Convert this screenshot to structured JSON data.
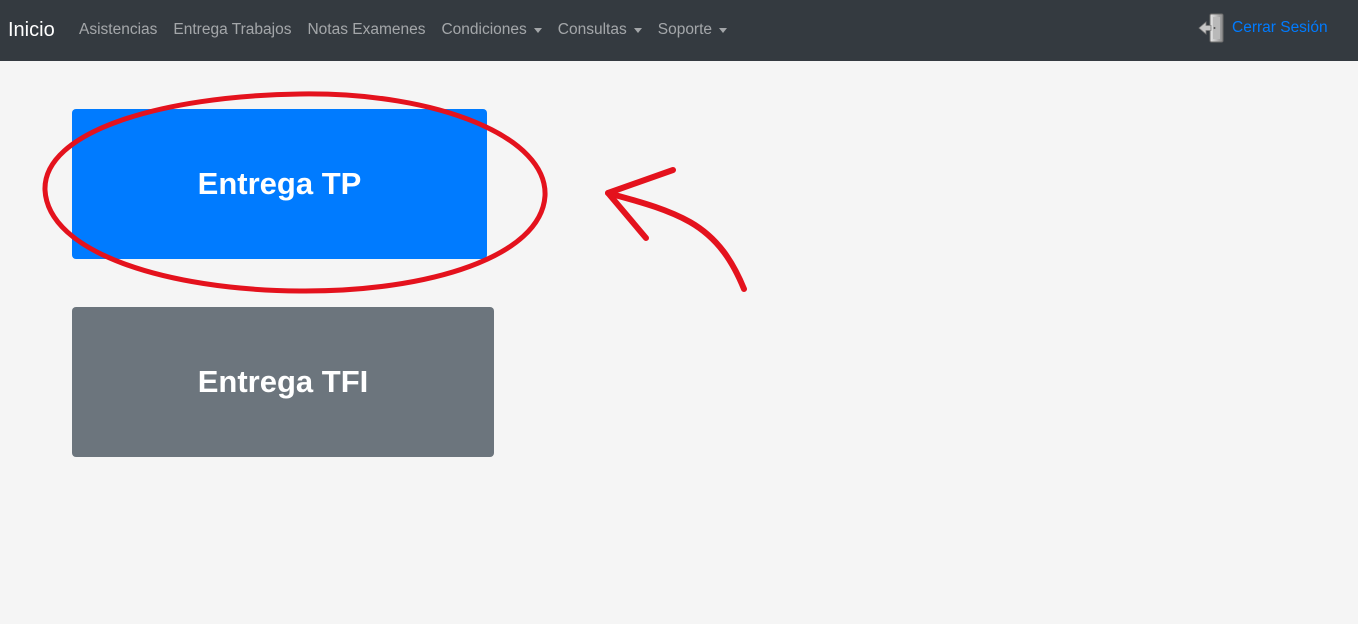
{
  "navbar": {
    "brand": "Inicio",
    "links": [
      {
        "label": "Asistencias",
        "dropdown": false
      },
      {
        "label": "Entrega Trabajos",
        "dropdown": false
      },
      {
        "label": "Notas Examenes",
        "dropdown": false
      },
      {
        "label": "Condiciones",
        "dropdown": true
      },
      {
        "label": "Consultas",
        "dropdown": true
      },
      {
        "label": "Soporte",
        "dropdown": true
      }
    ],
    "logout_label": "Cerrar Sesión",
    "logout_icon": "door-exit-icon"
  },
  "main": {
    "buttons": [
      {
        "label": "Entrega TP",
        "color": "#007bff"
      },
      {
        "label": "Entrega TFI",
        "color": "#6c757d"
      }
    ]
  },
  "annotation": {
    "color": "#e4121d",
    "shapes": [
      "ellipse-highlight",
      "curved-arrow"
    ]
  },
  "colors": {
    "navbar_bg": "#343a40",
    "page_bg": "#f5f5f5",
    "link_muted": "rgba(255,255,255,0.55)",
    "logout_link": "#007bff"
  }
}
